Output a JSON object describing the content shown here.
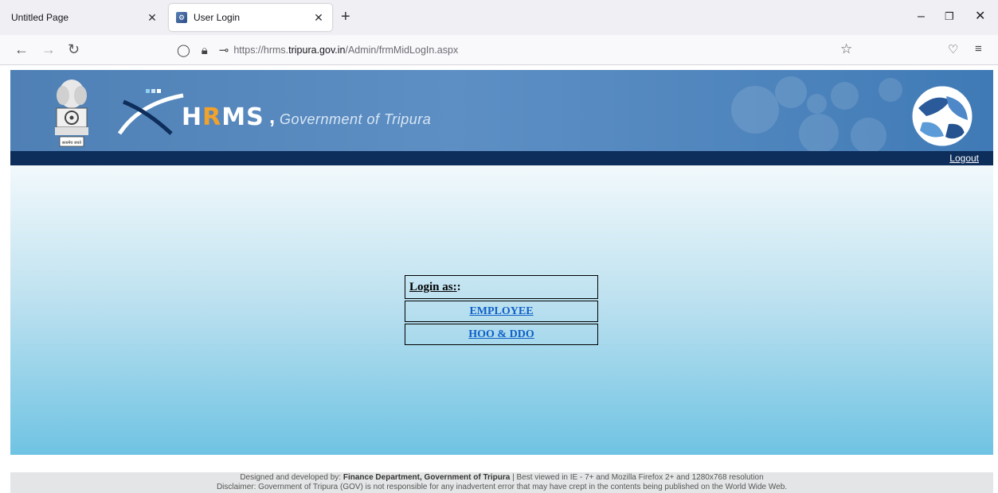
{
  "browser": {
    "tabs": [
      {
        "label": "Untitled Page",
        "active": false
      },
      {
        "label": "User Login",
        "active": true
      }
    ],
    "url_prefix": "https://hrms.",
    "url_host": "tripura.gov.in",
    "url_path": "/Admin/frmMidLogIn.aspx"
  },
  "header": {
    "brand": "HRMS",
    "brand_parts": [
      "H",
      "R",
      "MS"
    ],
    "comma": ",",
    "subtitle": "Government of Tripura",
    "emblem_caption": "सत्यमेव जयते"
  },
  "nav": {
    "logout_label": "Logout"
  },
  "login": {
    "title_label": "Login as:",
    "title_suffix": " :",
    "options": [
      "EMPLOYEE",
      "HOO & DDO"
    ]
  },
  "footer": {
    "line1_prefix": "Designed and developed by: ",
    "line1_bold": "Finance Department, Government of Tripura",
    "line1_suffix": " | Best viewed in IE - 7+ and Mozilla Firefox 2+ and 1280x768 resolution",
    "line2": "Disclaimer: Government of Tripura (GOV) is not responsible for any inadvertent error that may have crept in the contents being published on the World Wide Web."
  },
  "colors": {
    "header_blue": "#5d8fc4",
    "dark_bar": "#0d2d5b",
    "link_blue": "#1060c8",
    "brand_accent": "#f2a22a"
  }
}
